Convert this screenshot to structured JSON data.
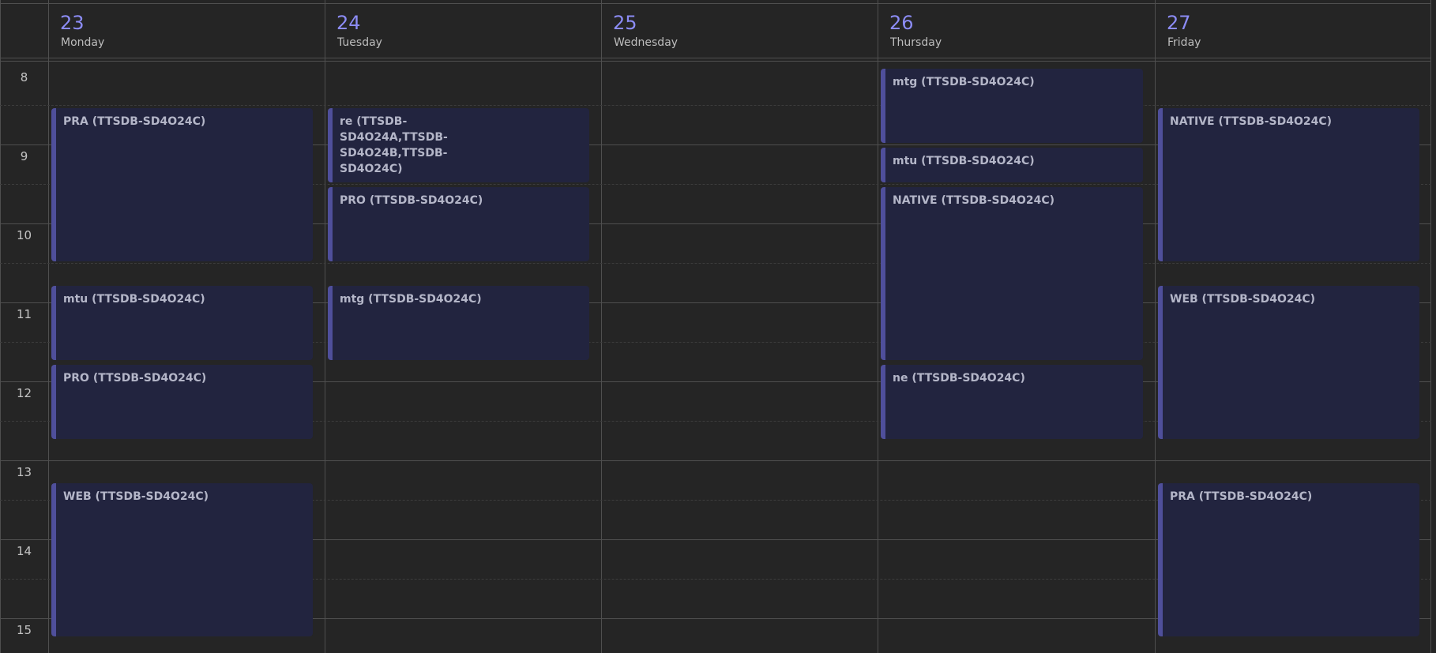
{
  "days": [
    {
      "number": "23",
      "name": "Monday"
    },
    {
      "number": "24",
      "name": "Tuesday"
    },
    {
      "number": "25",
      "name": "Wednesday"
    },
    {
      "number": "26",
      "name": "Thursday"
    },
    {
      "number": "27",
      "name": "Friday"
    }
  ],
  "hours": [
    "8",
    "9",
    "10",
    "11",
    "12",
    "13",
    "14",
    "15"
  ],
  "events": {
    "mon": [
      {
        "title": "PRA (TTSDB-SD4O24C)"
      },
      {
        "title": "mtu (TTSDB-SD4O24C)"
      },
      {
        "title": "PRO (TTSDB-SD4O24C)"
      },
      {
        "title": "WEB (TTSDB-SD4O24C)"
      }
    ],
    "tue": [
      {
        "title": "re (TTSDB-SD4O24A,TTSDB-SD4O24B,TTSDB-SD4O24C)"
      },
      {
        "title": "PRO (TTSDB-SD4O24C)"
      },
      {
        "title": "mtg (TTSDB-SD4O24C)"
      }
    ],
    "thu": [
      {
        "title": "mtg (TTSDB-SD4O24C)"
      },
      {
        "title": "mtu (TTSDB-SD4O24C)"
      },
      {
        "title": "NATIVE (TTSDB-SD4O24C)"
      },
      {
        "title": "ne (TTSDB-SD4O24C)"
      }
    ],
    "fri": [
      {
        "title": "NATIVE (TTSDB-SD4O24C)"
      },
      {
        "title": "WEB (TTSDB-SD4O24C)"
      },
      {
        "title": "PRA (TTSDB-SD4O24C)"
      }
    ]
  }
}
